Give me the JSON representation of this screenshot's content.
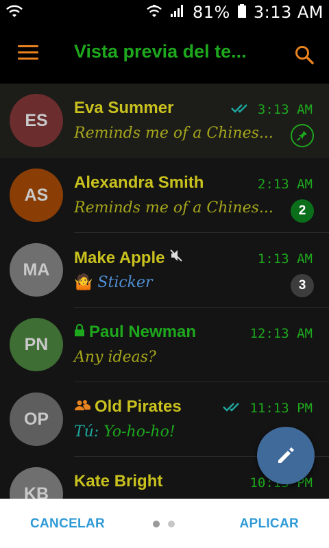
{
  "status_bar": {
    "battery": "81%",
    "time": "3:13 AM"
  },
  "app_bar": {
    "title": "Vista previa del te..."
  },
  "chats": [
    {
      "initials": "ES",
      "name": "Eva Summer",
      "time": "3:13 AM",
      "message": "Reminds me of a Chines...",
      "avatar_color": "#6b2d2d",
      "read": true,
      "pinned": true,
      "active": true
    },
    {
      "initials": "AS",
      "name": "Alexandra Smith",
      "time": "2:13 AM",
      "message": "Reminds me of a Chines...",
      "avatar_color": "#8a3e06",
      "unread": "2",
      "badge_color": "#0b6e1a"
    },
    {
      "initials": "MA",
      "name": "Make Apple",
      "time": "1:13 AM",
      "message": "Sticker",
      "avatar_color": "#6f6f6f",
      "muted": true,
      "sticker": true,
      "unread": "3",
      "badge_color": "#3d3d3d"
    },
    {
      "initials": "PN",
      "name": "Paul Newman",
      "time": "12:13 AM",
      "message": "Any ideas?",
      "avatar_color": "#3e6e33",
      "locked": true
    },
    {
      "initials": "OP",
      "name": "Old Pirates",
      "time": "11:13 PM",
      "sender": "Tú:",
      "message": "Yo-ho-ho!",
      "avatar_color": "#5e5e5e",
      "group": true,
      "read": true
    },
    {
      "initials": "KB",
      "name": "Kate Bright",
      "time": "10:13 PM",
      "message": "",
      "avatar_color": "#6f6f6f"
    }
  ],
  "bottom": {
    "cancel": "CANCELAR",
    "apply": "APLICAR"
  },
  "colors": {
    "accent_orange": "#e8821e",
    "title_green": "#1ea81e",
    "name_yellow": "#c9c21e",
    "fab_blue": "#3f6a9a",
    "button_blue": "#2f9ad6"
  }
}
